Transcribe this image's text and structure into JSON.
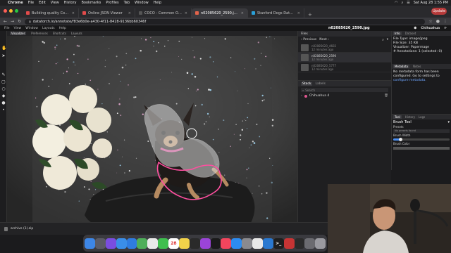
{
  "menubar": {
    "apple": "",
    "app": "Chrome",
    "items": [
      "File",
      "Edit",
      "View",
      "History",
      "Bookmarks",
      "Profiles",
      "Tab",
      "Window",
      "Help"
    ],
    "clock": "Sat Aug 28  1:55 PM"
  },
  "tabs": [
    {
      "label": "Building quality Computer Vi...",
      "color": "#e24b4b",
      "active": false
    },
    {
      "label": "Online JSON Viewer",
      "color": "#e24b4b",
      "active": false
    },
    {
      "label": "COCO - Common Objects in C...",
      "color": "#555555",
      "active": false
    },
    {
      "label": "n02085620_2590.jpg - Annot...",
      "color": "#e2644b",
      "active": true
    },
    {
      "label": "Stanford Dogs Dataset | Kagg...",
      "color": "#2aa0d8",
      "active": false
    }
  ],
  "update_label": "Update",
  "address": {
    "url": "datatorch.io/annotate/f83e6b0e-a430-4f11-8428-9136bb60346f"
  },
  "appbar": {
    "items": [
      "File",
      "View",
      "Window",
      "Layouts",
      "Help"
    ],
    "file_title": "n02085620_2590.jpg",
    "label": "Chihuahua"
  },
  "visualizer_tabs": [
    "Visualizer",
    "Preferences",
    "Shortcuts",
    "Layouts"
  ],
  "files": {
    "header": "Files",
    "prev_label": "Previous",
    "next_label": "Next",
    "items": [
      {
        "name": "n02085620_4602",
        "time": "12 minutes ago",
        "selected": false
      },
      {
        "name": "n02085620_2590",
        "time": "12 minutes ago",
        "selected": true
      },
      {
        "name": "n02085620_5777",
        "time": "12 minutes ago",
        "selected": false
      }
    ]
  },
  "stack": {
    "tabs": [
      "Stack",
      "Labels"
    ],
    "search_placeholder": "Search",
    "items": [
      {
        "label": "Chihuahua 4"
      }
    ]
  },
  "info": {
    "tabs": [
      "Info",
      "Dataset"
    ],
    "lines": [
      "File Type: image/jpeg",
      "File Size: 35 KB",
      "Visualizer: Papermage",
      "# Annotations: 1 (selected: 0)"
    ],
    "meta_tabs": [
      "Metadata",
      "Notes"
    ],
    "meta_text": [
      "No metadata form has been",
      "configured. Go to settings to"
    ],
    "meta_link": "configure metadata."
  },
  "tool": {
    "tabs": [
      "Tool",
      "History",
      "Logs"
    ],
    "name": "Brush Tool",
    "presets_label": "Presets",
    "presets_value": "No presets found",
    "width_label": "Brush Width",
    "width_level": 0.12,
    "color_label": "Brush Color"
  },
  "downloads": {
    "file": "archive (1).zip"
  },
  "dock": [
    {
      "icon": "finder-icon",
      "color": "#3d86e6",
      "glyph": ""
    },
    {
      "icon": "launchpad-icon",
      "color": "#5b5b66",
      "glyph": ""
    },
    {
      "icon": "siri-icon",
      "color": "#7a4de0",
      "glyph": ""
    },
    {
      "icon": "mail-icon",
      "color": "#3a8ee8",
      "glyph": ""
    },
    {
      "icon": "safari-icon",
      "color": "#2f7ce0",
      "glyph": ""
    },
    {
      "icon": "maps-icon",
      "color": "#4fae5a",
      "glyph": ""
    },
    {
      "icon": "photos-icon",
      "color": "#e9e9e9",
      "glyph": ""
    },
    {
      "icon": "facetime-icon",
      "color": "#3fbf4f",
      "glyph": ""
    },
    {
      "icon": "calendar-icon",
      "color": "#ffffff",
      "glyph": "28"
    },
    {
      "icon": "notes-icon",
      "color": "#f2d24a",
      "glyph": ""
    },
    {
      "icon": "finder-window-icon",
      "color": "#2a2a2a",
      "glyph": ""
    },
    {
      "icon": "podcasts-icon",
      "color": "#9b44d8",
      "glyph": ""
    },
    {
      "icon": "apple-tv-icon",
      "color": "#1a1a1a",
      "glyph": ""
    },
    {
      "icon": "music-icon",
      "color": "#f4455d",
      "glyph": ""
    },
    {
      "icon": "app-store-icon",
      "color": "#2d8cf0",
      "glyph": ""
    },
    {
      "icon": "settings-icon",
      "color": "#8a8a8f",
      "glyph": ""
    },
    {
      "icon": "chrome-icon",
      "color": "#e8e8e8",
      "glyph": ""
    },
    {
      "icon": "vscode-icon",
      "color": "#2a78cf",
      "glyph": ""
    },
    {
      "icon": "terminal-icon",
      "color": "#1e1e1e",
      "glyph": ">_"
    },
    {
      "icon": "screen-recorder-icon",
      "color": "#c73434",
      "glyph": ""
    },
    {
      "icon": "obs-icon",
      "color": "#2b2b2b",
      "glyph": ""
    },
    {
      "icon": "preview-icon",
      "color": "#6b6b70",
      "glyph": ""
    },
    {
      "icon": "trash-icon",
      "color": "#9a9aa0",
      "glyph": ""
    }
  ]
}
